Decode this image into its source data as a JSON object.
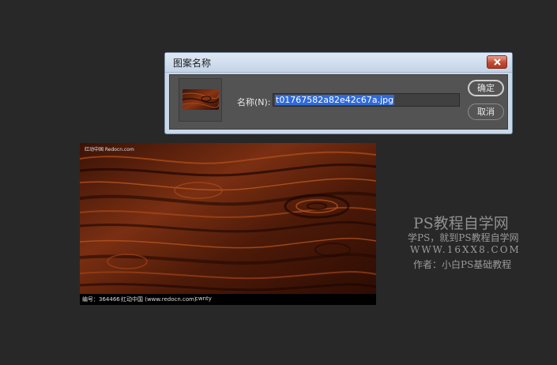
{
  "dialog": {
    "title": "图案名称",
    "name_label": "名称(N):",
    "name_value": "t01767582a82e42c67a.jpg",
    "ok_label": "确定",
    "cancel_label": "取消",
    "close_icon": "close-icon",
    "thumbnail": "wood-texture-thumbnail"
  },
  "image": {
    "top_caption": "红动中国 Redocn.com",
    "footer_id": "编号：364466",
    "footer_site": "红动中国 (www.redocn.com)",
    "footer_author": "cwnty"
  },
  "watermark": {
    "line1": "PS教程自学网",
    "line2": "学PS，就到PS教程自学网",
    "line3": "WWW.16XX8.COM",
    "line4": "作者：小白PS基础教程"
  },
  "colors": {
    "background": "#282828",
    "dialog_frame": "#c9d9ea",
    "dialog_body": "#535353",
    "selection": "#2f6ad8",
    "wood": "#7a2f12"
  }
}
